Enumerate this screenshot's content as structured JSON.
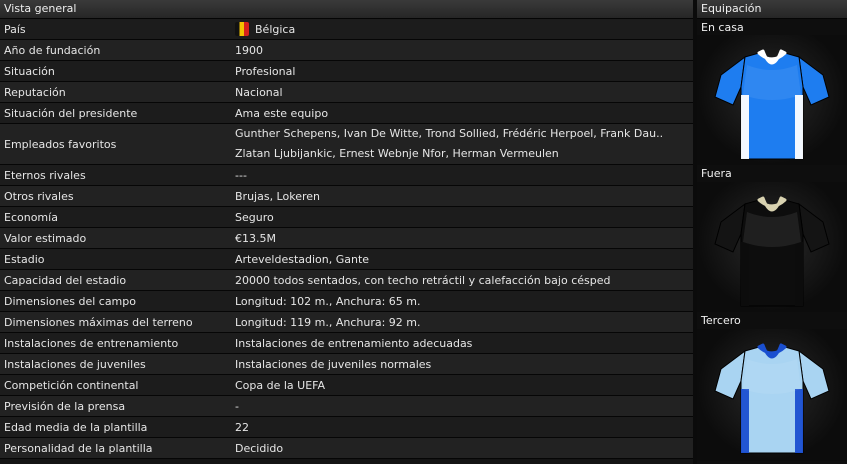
{
  "overview": {
    "header": "Vista general",
    "country_flag": "belgium-flag",
    "rows": [
      {
        "label": "País",
        "value": "Bélgica"
      },
      {
        "label": "Año de fundación",
        "value": "1900"
      },
      {
        "label": "Situación",
        "value": "Profesional"
      },
      {
        "label": "Reputación",
        "value": "Nacional"
      },
      {
        "label": "Situación del presidente",
        "value": "Ama este equipo"
      },
      {
        "label": "Empleados favoritos",
        "value": "Gunther Schepens, Ivan De Witte, Trond Sollied, Frédéric Herpoel, Frank Dau..",
        "value2": "Zlatan Ljubijankic, Ernest Webnje Nfor, Herman Vermeulen"
      },
      {
        "label": "Eternos rivales",
        "value": "---"
      },
      {
        "label": "Otros rivales",
        "value": "Brujas, Lokeren"
      },
      {
        "label": "Economía",
        "value": "Seguro"
      },
      {
        "label": "Valor estimado",
        "value": "€13.5M"
      },
      {
        "label": "Estadio",
        "value": "Arteveldestadion, Gante"
      },
      {
        "label": "Capacidad del estadio",
        "value": "20000 todos sentados, con techo retráctil y calefacción bajo césped"
      },
      {
        "label": "Dimensiones del campo",
        "value": "Longitud: 102 m., Anchura: 65 m."
      },
      {
        "label": "Dimensiones máximas del terreno",
        "value": "Longitud: 119 m., Anchura: 92 m."
      },
      {
        "label": "Instalaciones de entrenamiento",
        "value": "Instalaciones de entrenamiento adecuadas"
      },
      {
        "label": "Instalaciones de juveniles",
        "value": "Instalaciones de juveniles normales"
      },
      {
        "label": "Competición continental",
        "value": "Copa de la UEFA"
      },
      {
        "label": "Previsión de la prensa",
        "value": "-"
      },
      {
        "label": "Edad media de la plantilla",
        "value": "22"
      },
      {
        "label": "Personalidad de la plantilla",
        "value": "Decidido"
      }
    ]
  },
  "kits": {
    "header": "Equipación",
    "home": {
      "label": "En casa",
      "body": "#1e7df0",
      "sleeve": "#1e7df0",
      "side": "#ffffff",
      "collar": "#ffffff"
    },
    "away": {
      "label": "Fuera",
      "body": "#0d0d0d",
      "sleeve": "#141414",
      "side": "#0d0d0d",
      "collar": "#d8d2b0"
    },
    "third": {
      "label": "Tercero",
      "body": "#a9d4f2",
      "sleeve": "#a9d4f2",
      "side": "#1a4fd0",
      "collar": "#1a4fd0"
    }
  }
}
